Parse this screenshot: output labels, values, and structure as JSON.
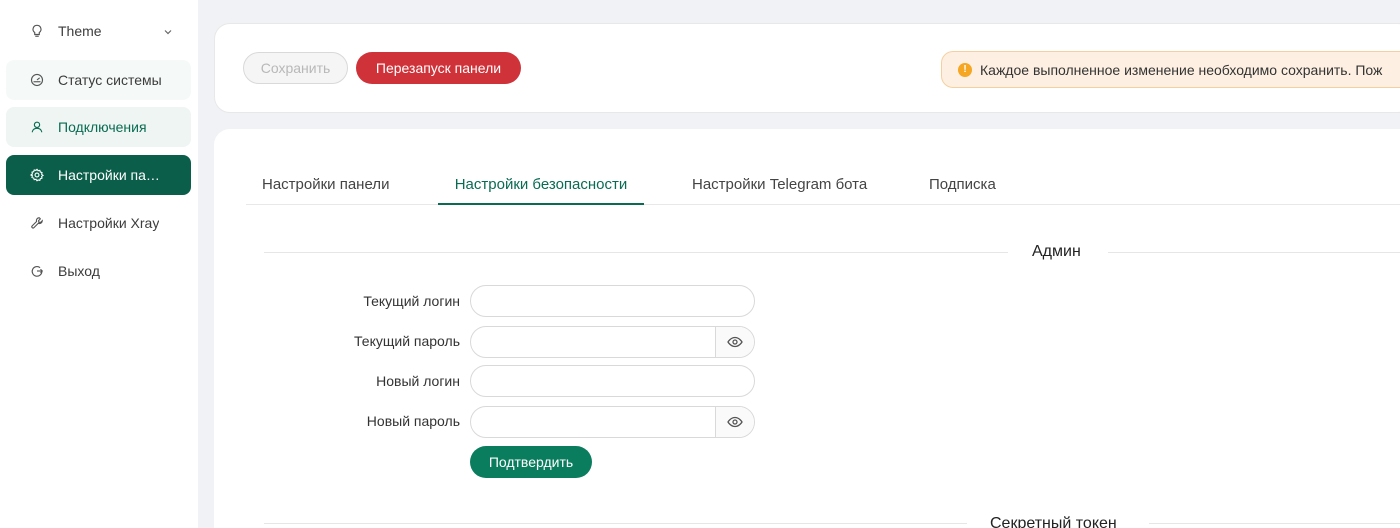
{
  "sidebar": {
    "theme": {
      "label": "Theme",
      "icon": "bulb-icon"
    },
    "items": [
      {
        "label": "Статус системы",
        "icon": "dashboard-icon"
      },
      {
        "label": "Подключения",
        "icon": "user-icon"
      },
      {
        "label": "Настройки па…",
        "icon": "gear-icon"
      },
      {
        "label": "Настройки Xray",
        "icon": "tool-icon"
      },
      {
        "label": "Выход",
        "icon": "logout-icon"
      }
    ]
  },
  "toolbar": {
    "save_label": "Сохранить",
    "restart_label": "Перезапуск панели",
    "alert_text": "Каждое выполненное изменение необходимо сохранить. Пож"
  },
  "tabs": [
    {
      "label": "Настройки панели"
    },
    {
      "label": "Настройки безопасности",
      "active": true
    },
    {
      "label": "Настройки Telegram бота"
    },
    {
      "label": "Подписка"
    }
  ],
  "admin": {
    "section_title": "Админ",
    "current_login_label": "Текущий логин",
    "current_login_value": "",
    "current_password_label": "Текущий пароль",
    "current_password_value": "",
    "new_login_label": "Новый логин",
    "new_login_value": "",
    "new_password_label": "Новый пароль",
    "new_password_value": "",
    "confirm_label": "Подтвердить"
  },
  "secret": {
    "section_title": "Секретный токен"
  },
  "colors": {
    "accent": "#0a6b52",
    "active_menu_bg": "#0b5f4a",
    "restart_button": "#cf3339",
    "confirm_button": "#0b7d5f",
    "alert_bg": "#fdf0e2",
    "alert_icon": "#f5a623"
  }
}
